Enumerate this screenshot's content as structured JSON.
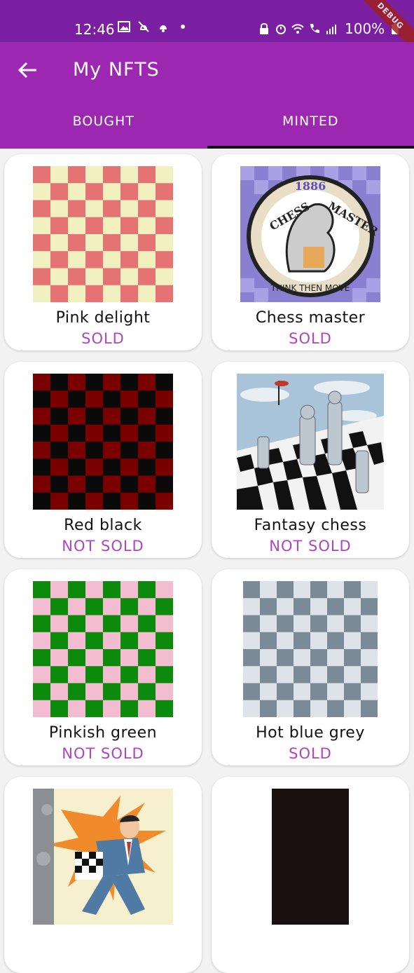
{
  "status_bar": {
    "time": "12:46",
    "battery": "100%",
    "debug_label": "DEBUG",
    "icons_left": [
      "image-icon",
      "no-disturb-icon",
      "bell-icon",
      "dot-icon"
    ],
    "icons_right": [
      "lock-icon",
      "alarm-icon",
      "wifi-icon",
      "call-icon",
      "signal-icon",
      "battery-icon"
    ]
  },
  "app_bar": {
    "title": "My NFTS",
    "back_icon": "arrow-left-icon"
  },
  "tabs": [
    {
      "label": "BOUGHT",
      "selected": false
    },
    {
      "label": "MINTED",
      "selected": true
    }
  ],
  "colors": {
    "status_bar": "#7b1fa2",
    "app_bar": "#9c27b0",
    "status_text": "#ab47bc",
    "tab_indicator": "#111111"
  },
  "nfts": [
    {
      "name": "Pink delight",
      "status": "SOLD",
      "image": "checkerboard-pink-cream"
    },
    {
      "name": "Chess master",
      "status": "SOLD",
      "image": "chess-master-badge"
    },
    {
      "name": "Red black",
      "status": "NOT SOLD",
      "image": "checkerboard-red-black"
    },
    {
      "name": "Fantasy chess",
      "status": "NOT SOLD",
      "image": "fantasy-chess-scene"
    },
    {
      "name": "Pinkish green",
      "status": "NOT SOLD",
      "image": "checkerboard-green-pink"
    },
    {
      "name": "Hot blue grey",
      "status": "SOLD",
      "image": "checkerboard-grey-white"
    },
    {
      "name": "",
      "status": "",
      "image": "comic-chess-man"
    },
    {
      "name": "",
      "status": "",
      "image": "dark-board"
    }
  ]
}
